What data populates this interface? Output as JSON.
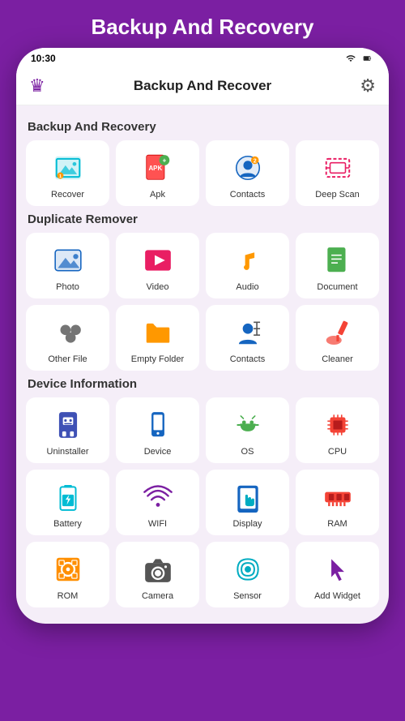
{
  "page": {
    "title": "Backup And Recovery",
    "status_bar": {
      "time": "10:30"
    },
    "top_bar": {
      "title": "Backup And Recover"
    }
  },
  "sections": [
    {
      "title": "Backup And Recovery",
      "items": [
        {
          "label": "Recover",
          "icon": "recover"
        },
        {
          "label": "Apk",
          "icon": "apk"
        },
        {
          "label": "Contacts",
          "icon": "contacts-backup"
        },
        {
          "label": "Deep Scan",
          "icon": "deepscan"
        }
      ]
    },
    {
      "title": "Duplicate Remover",
      "items": [
        {
          "label": "Photo",
          "icon": "photo"
        },
        {
          "label": "Video",
          "icon": "video"
        },
        {
          "label": "Audio",
          "icon": "audio"
        },
        {
          "label": "Document",
          "icon": "document"
        },
        {
          "label": "Other File",
          "icon": "otherfile"
        },
        {
          "label": "Empty Folder",
          "icon": "emptyfolder"
        },
        {
          "label": "Contacts",
          "icon": "contacts-dup"
        },
        {
          "label": "Cleaner",
          "icon": "cleaner"
        }
      ]
    },
    {
      "title": "Device Information",
      "items": [
        {
          "label": "Uninstaller",
          "icon": "uninstaller"
        },
        {
          "label": "Device",
          "icon": "device"
        },
        {
          "label": "OS",
          "icon": "os"
        },
        {
          "label": "CPU",
          "icon": "cpu"
        },
        {
          "label": "Battery",
          "icon": "battery"
        },
        {
          "label": "WIFI",
          "icon": "wifi"
        },
        {
          "label": "Display",
          "icon": "display"
        },
        {
          "label": "RAM",
          "icon": "ram"
        },
        {
          "label": "ROM",
          "icon": "rom"
        },
        {
          "label": "Camera",
          "icon": "camera"
        },
        {
          "label": "Sensor",
          "icon": "sensor"
        },
        {
          "label": "Add Widget",
          "icon": "addwidget"
        }
      ]
    }
  ]
}
